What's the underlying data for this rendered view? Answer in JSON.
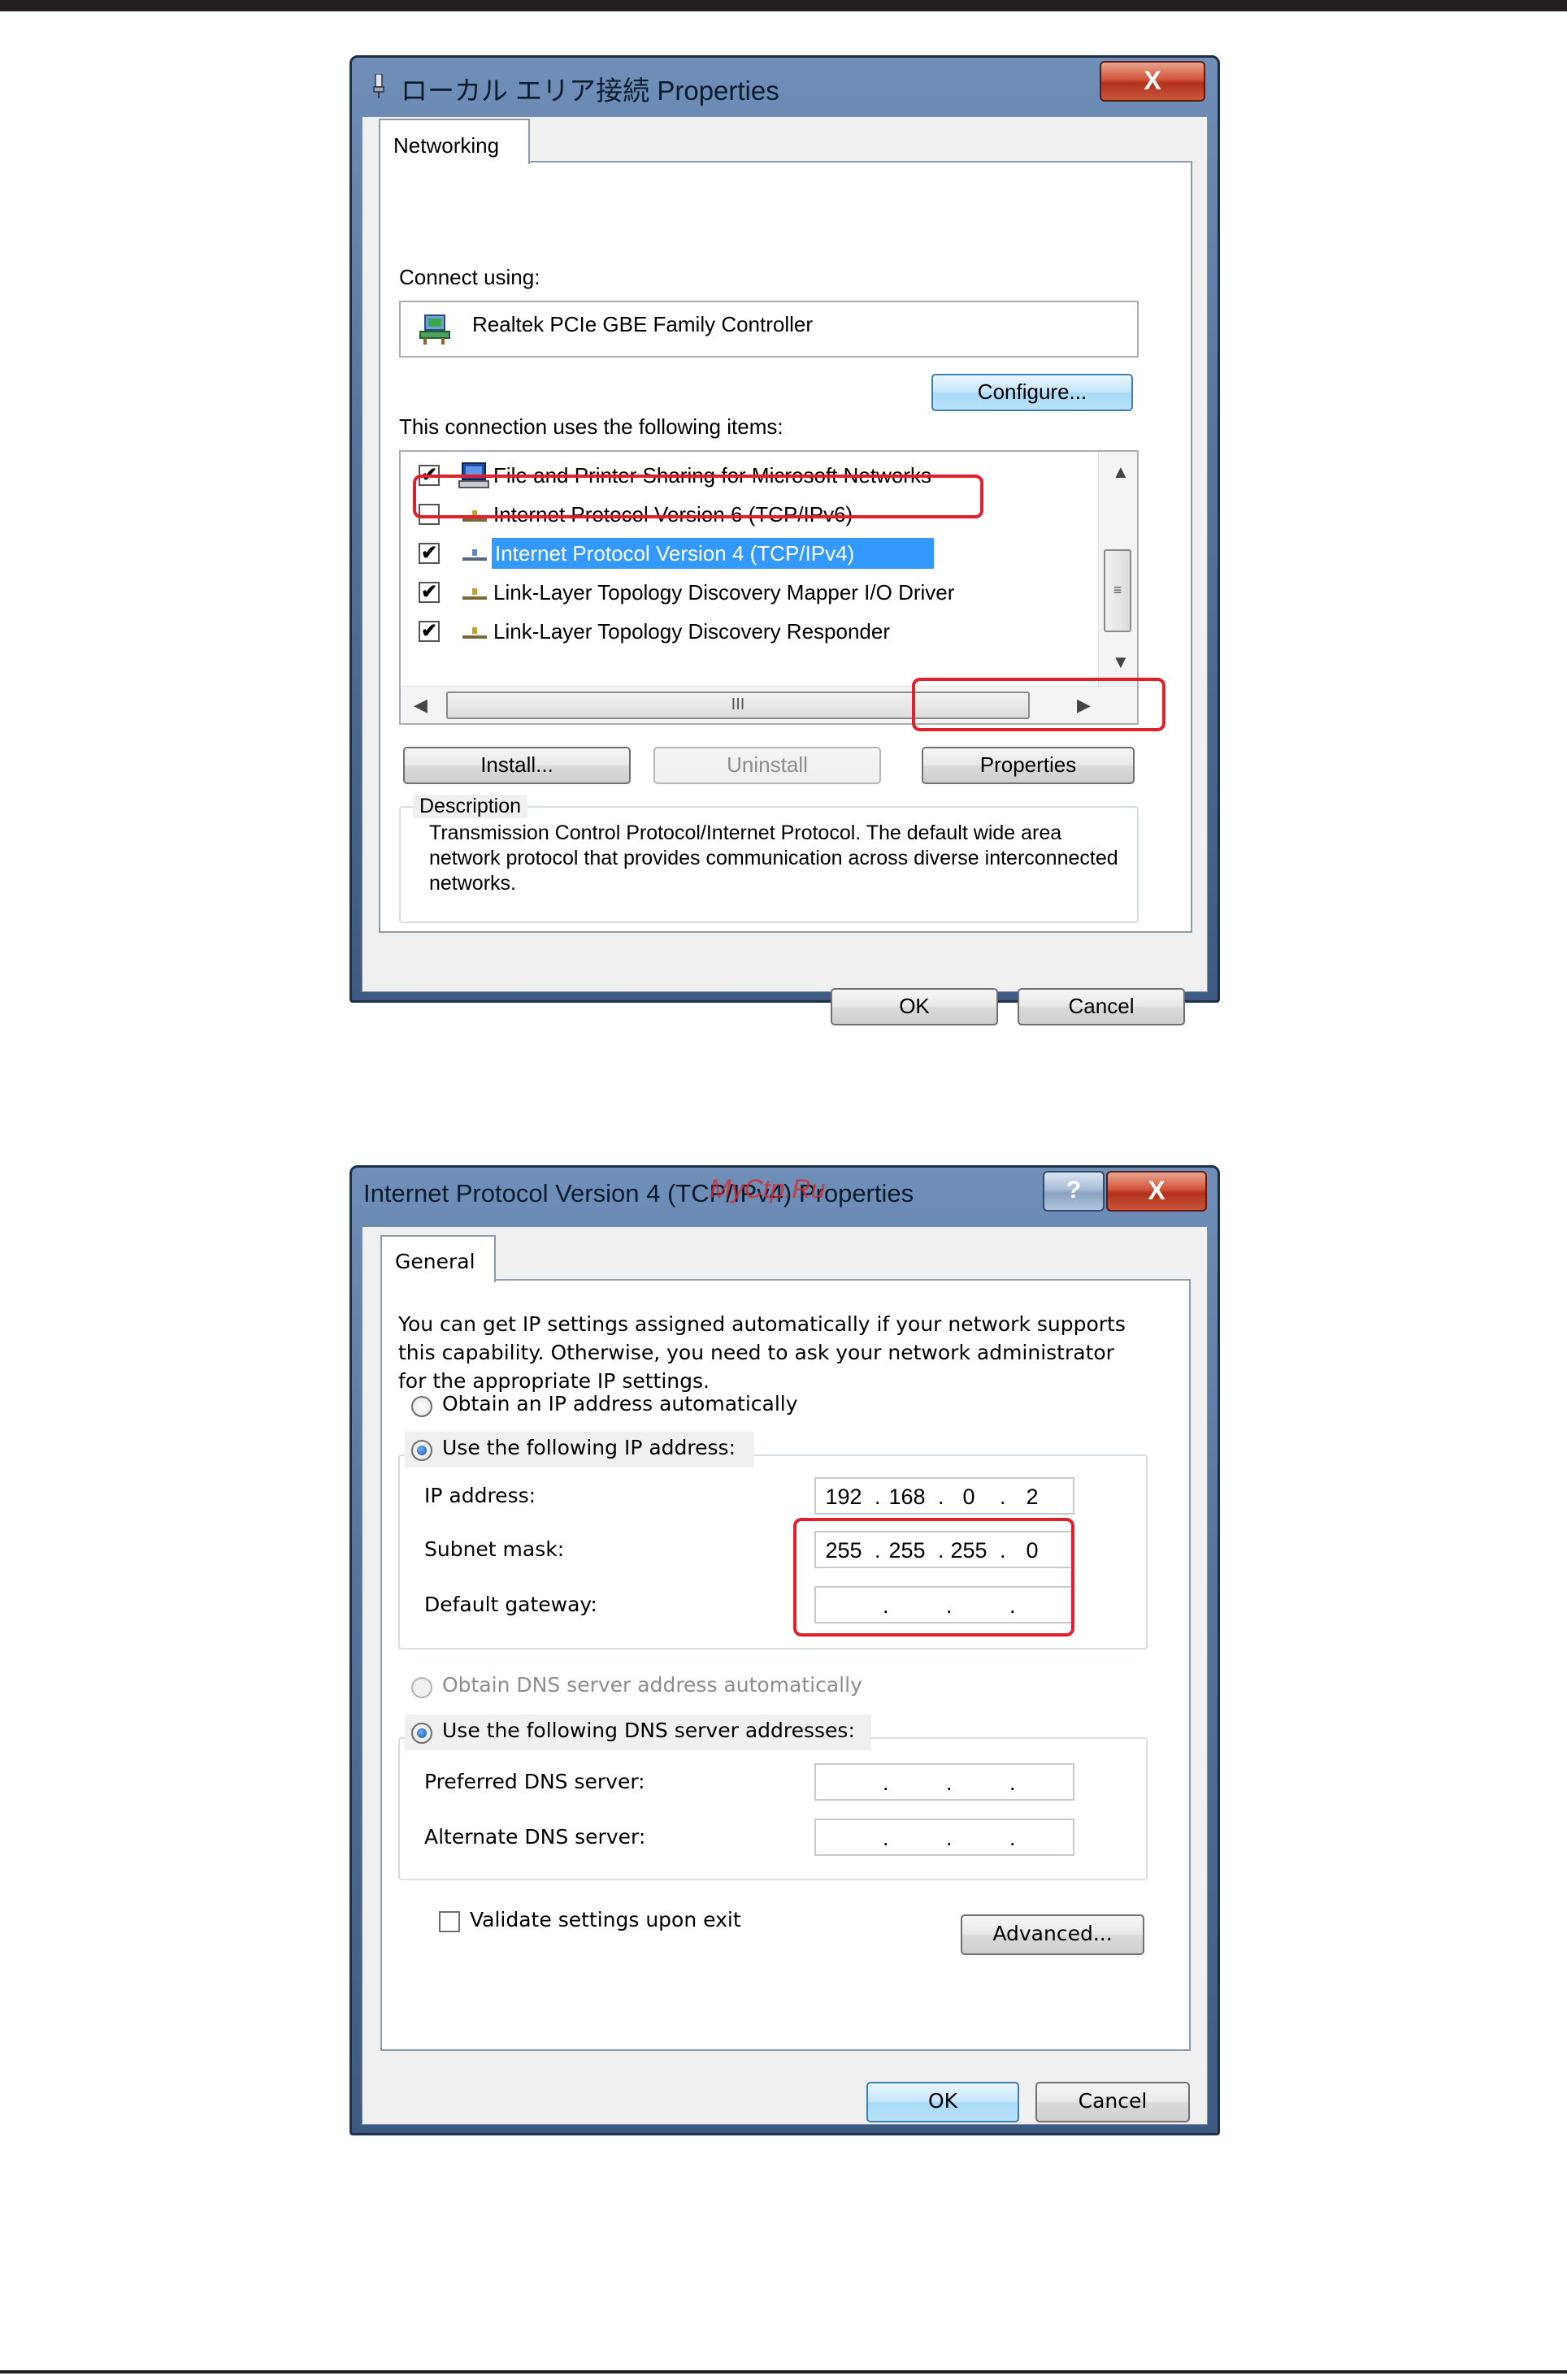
{
  "dialog1": {
    "title": "ローカル エリア接続 Properties",
    "close_label": "X",
    "tab": "Networking",
    "connect_using_label": "Connect using:",
    "adapter_name": "Realtek PCIe GBE Family Controller",
    "configure_button": "Configure...",
    "items_label": "This connection uses the following items:",
    "items": [
      {
        "label": "File and Printer Sharing for Microsoft Networks",
        "checked": true
      },
      {
        "label": "Internet Protocol Version 6 (TCP/IPv6)",
        "checked": false
      },
      {
        "label": "Internet Protocol Version 4 (TCP/IPv4)",
        "checked": true,
        "selected": true
      },
      {
        "label": "Link-Layer Topology Discovery Mapper I/O Driver",
        "checked": true
      },
      {
        "label": "Link-Layer Topology Discovery Responder",
        "checked": true
      }
    ],
    "hscroll_thumb_label": "III",
    "install_button": "Install...",
    "uninstall_button": "Uninstall",
    "properties_button": "Properties",
    "description_label": "Description",
    "description_text": "Transmission Control Protocol/Internet Protocol. The default wide area network protocol that provides communication across diverse interconnected networks.",
    "ok_button": "OK",
    "cancel_button": "Cancel",
    "check_glyph": "✔"
  },
  "dialog2": {
    "title": "Internet Protocol Version 4 (TCP/IPv4) Properties",
    "watermark": "MyCtp.Ru",
    "help_label": "?",
    "close_label": "X",
    "tab": "General",
    "intro_text": "You can get IP settings assigned automatically if your network supports this capability. Otherwise, you need to ask your network administrator for the appropriate IP settings.",
    "obtain_ip_auto": "Obtain an IP address automatically",
    "use_following_ip": "Use the following IP address:",
    "ip_address_label": "IP address:",
    "ip_address": [
      "192",
      "168",
      "0",
      "2"
    ],
    "subnet_mask_label": "Subnet mask:",
    "subnet_mask": [
      "255",
      "255",
      "255",
      "0"
    ],
    "default_gateway_label": "Default gateway:",
    "obtain_dns_auto": "Obtain DNS server address automatically",
    "use_following_dns": "Use the following DNS server addresses:",
    "preferred_dns_label": "Preferred DNS server:",
    "alternate_dns_label": "Alternate DNS server:",
    "validate_label": "Validate settings upon exit",
    "advanced_button": "Advanced...",
    "ok_button": "OK",
    "cancel_button": "Cancel",
    "dot": "."
  },
  "colors": {
    "highlight_red": "#e0202a",
    "selection_blue": "#3399ff"
  }
}
